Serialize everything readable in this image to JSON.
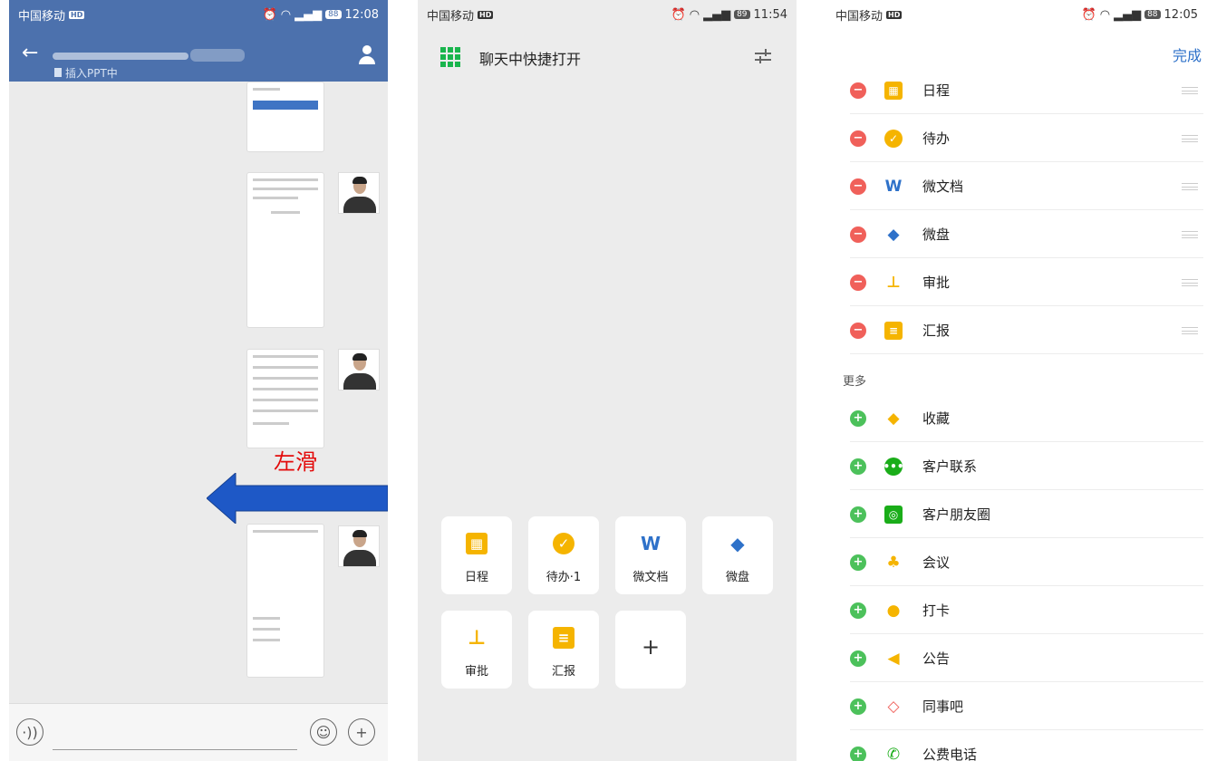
{
  "screen1": {
    "status": {
      "carrier": "中国移动",
      "hd": "HD",
      "battery": "88",
      "time": "12:08"
    },
    "header": {
      "subtitle": "插入PPT中"
    },
    "swipe_label": "左滑"
  },
  "screen2": {
    "status": {
      "carrier": "中国移动",
      "hd": "HD",
      "battery": "89",
      "time": "11:54"
    },
    "title": "聊天中快捷打开",
    "tiles": [
      {
        "label": "日程",
        "icon": "calendar-icon",
        "color": "#f5b400"
      },
      {
        "label": "待办·1",
        "icon": "check-icon",
        "color": "#f5b400"
      },
      {
        "label": "微文档",
        "icon": "w-doc-icon",
        "color": "#2e71c9"
      },
      {
        "label": "微盘",
        "icon": "cloud-disk-icon",
        "color": "#2e71c9"
      },
      {
        "label": "审批",
        "icon": "stamp-icon",
        "color": "#f5b400"
      },
      {
        "label": "汇报",
        "icon": "report-icon",
        "color": "#f5b400"
      },
      {
        "label": "+",
        "icon": "add-icon",
        "color": "#333333"
      }
    ]
  },
  "screen3": {
    "status": {
      "carrier": "中国移动",
      "hd": "HD",
      "battery": "88",
      "time": "12:05"
    },
    "done_label": "完成",
    "active": [
      {
        "name": "日程",
        "icon": "calendar-icon",
        "color": "#f5b400",
        "glyph": "▦"
      },
      {
        "name": "待办",
        "icon": "check-icon",
        "color": "#f5b400",
        "glyph": "✓"
      },
      {
        "name": "微文档",
        "icon": "w-doc-icon",
        "color": "#2e71c9",
        "glyph": "W"
      },
      {
        "name": "微盘",
        "icon": "cloud-disk-icon",
        "color": "#2e71c9",
        "glyph": "◆"
      },
      {
        "name": "审批",
        "icon": "stamp-icon",
        "color": "#f5b400",
        "glyph": "⊥"
      },
      {
        "name": "汇报",
        "icon": "report-icon",
        "color": "#f5b400",
        "glyph": "≡"
      }
    ],
    "more_label": "更多",
    "more": [
      {
        "name": "收藏",
        "icon": "favorite-box-icon",
        "color": "#f5b400",
        "glyph": "◆"
      },
      {
        "name": "客户联系",
        "icon": "chat-bubble-icon",
        "color": "#1aad19",
        "glyph": "•••"
      },
      {
        "name": "客户朋友圈",
        "icon": "moments-icon",
        "color": "#1aad19",
        "glyph": "◎"
      },
      {
        "name": "会议",
        "icon": "meeting-icon",
        "color": "#f5b400",
        "glyph": "♣"
      },
      {
        "name": "打卡",
        "icon": "location-pin-icon",
        "color": "#f5b400",
        "glyph": "●"
      },
      {
        "name": "公告",
        "icon": "megaphone-icon",
        "color": "#f5b400",
        "glyph": "◀"
      },
      {
        "name": "同事吧",
        "icon": "colleague-icon",
        "color": "#f0605a",
        "glyph": "◇"
      },
      {
        "name": "公费电话",
        "icon": "phone-icon",
        "color": "#1aad19",
        "glyph": "✆"
      }
    ]
  }
}
